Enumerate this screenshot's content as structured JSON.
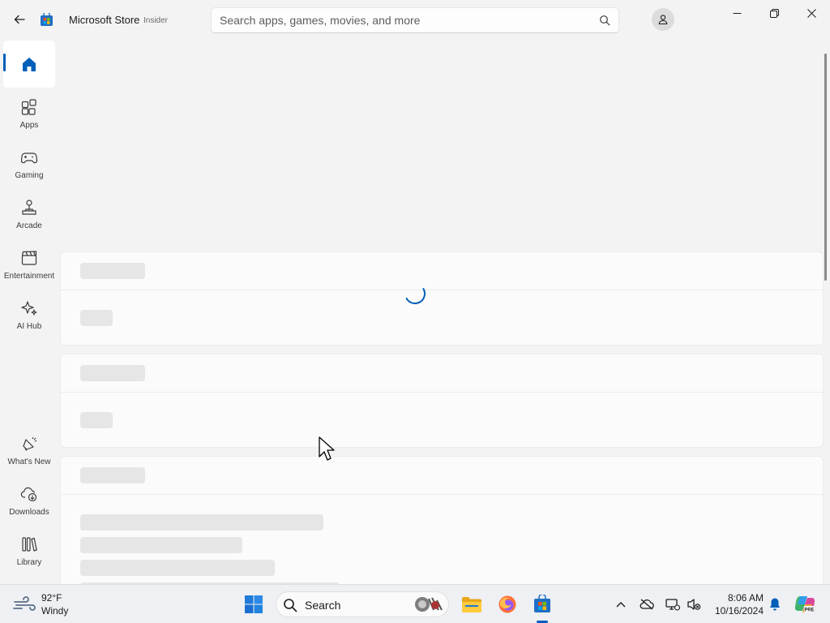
{
  "titlebar": {
    "app_title": "Microsoft Store",
    "app_badge": "Insider",
    "search_placeholder": "Search apps, games, movies, and more"
  },
  "nav": {
    "items": [
      {
        "label": "Apps"
      },
      {
        "label": "Gaming"
      },
      {
        "label": "Arcade"
      },
      {
        "label": "Entertainment"
      },
      {
        "label": "AI Hub"
      }
    ],
    "bottom_items": [
      {
        "label": "What's New"
      },
      {
        "label": "Downloads"
      },
      {
        "label": "Library"
      }
    ]
  },
  "taskbar": {
    "weather_temp": "92°F",
    "weather_condition": "Windy",
    "search_label": "Search",
    "time": "8:06 AM",
    "date": "10/16/2024"
  },
  "colors": {
    "accent": "#005fb8",
    "background": "#f3f3f3",
    "card": "#fbfbfb",
    "skeleton": "#e6e6e6"
  },
  "status": {
    "loading": true
  }
}
